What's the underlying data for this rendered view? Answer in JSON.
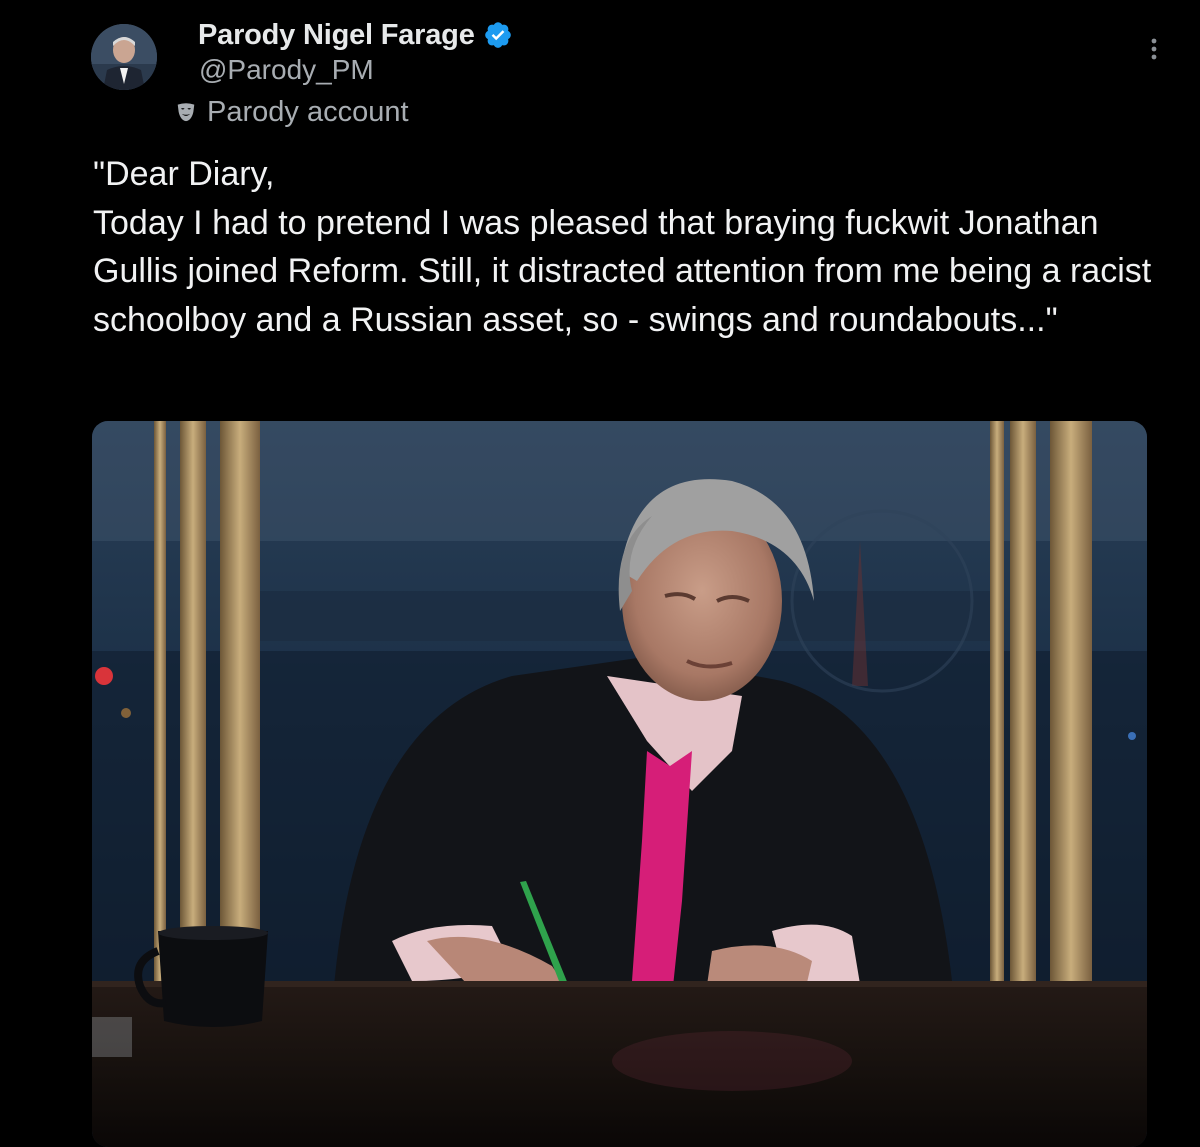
{
  "author": {
    "display_name": "Parody Nigel Farage",
    "handle": "@Parody_PM",
    "account_label": "Parody account",
    "verified_icon": "verified-badge-icon",
    "account_label_icon": "parody-mask-icon",
    "avatar_icon": "avatar"
  },
  "tweet": {
    "text": "\"Dear Diary,\nToday I had to pretend I was pleased that braying fuckwit Jonathan Gullis joined Reform. Still, it distracted attention from me being a racist schoolboy and a Russian asset, so - swings and roundabouts...\""
  },
  "media": {
    "type": "photo"
  },
  "actions": {
    "more_icon": "more-vertical-icon"
  },
  "colors": {
    "background": "#000000",
    "text_primary": "#e7e9ea",
    "text_secondary": "#a8adb2",
    "verified_blue": "#1d9bf0"
  }
}
